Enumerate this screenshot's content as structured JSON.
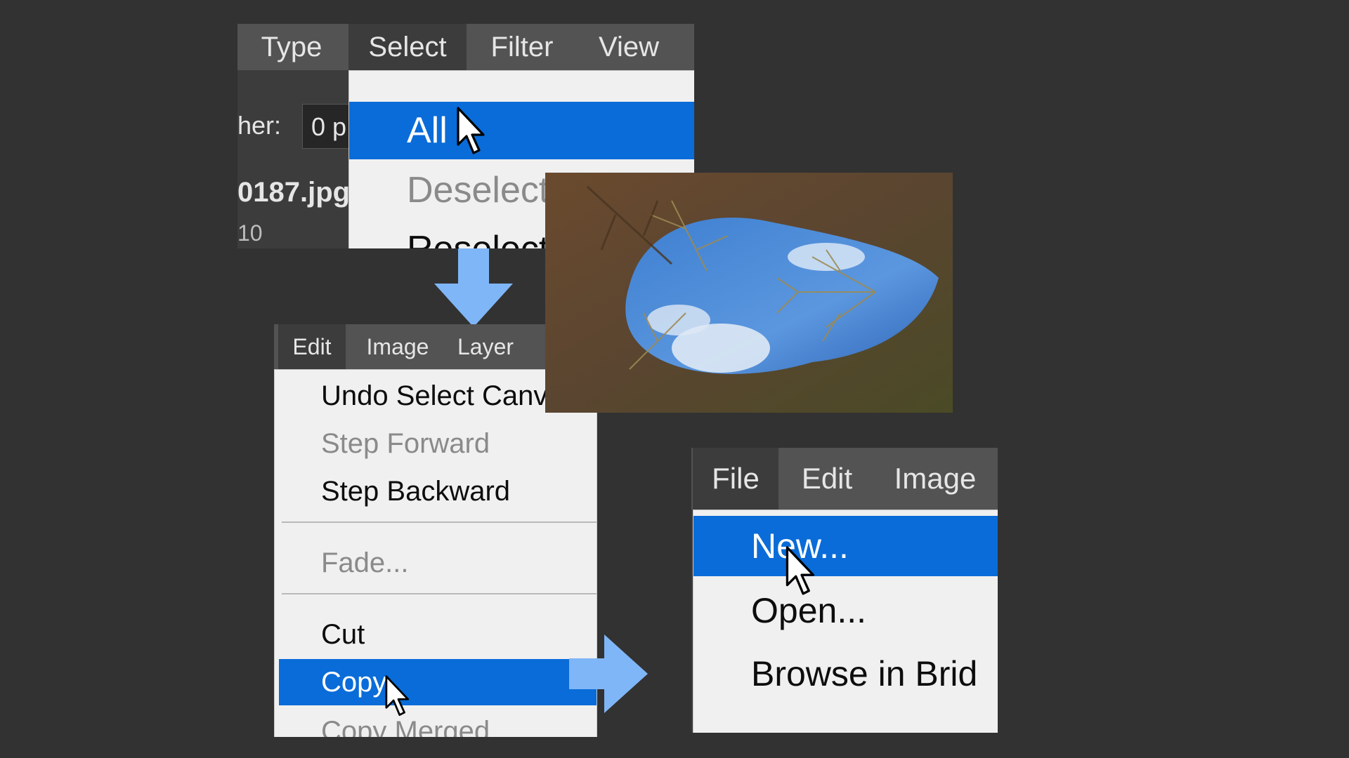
{
  "panel1": {
    "menubar": [
      "Type",
      "Select",
      "Filter",
      "View"
    ],
    "feather_label": "her:",
    "feather_value": "0 p",
    "doc_name": "0187.jpg",
    "doc_zoom": "10",
    "menu": [
      "All",
      "Deselect",
      "Reselect"
    ]
  },
  "panel2": {
    "menubar": [
      "Edit",
      "Image",
      "Layer"
    ],
    "menu": [
      "Undo Select Canv",
      "Step Forward",
      "Step Backward",
      "Fade...",
      "Cut",
      "Copy",
      "Copy Merged"
    ]
  },
  "panel3": {
    "menubar": [
      "File",
      "Edit",
      "Image"
    ],
    "menu": [
      "New...",
      "Open...",
      "Browse in Brid"
    ]
  },
  "colors": {
    "background": "#323232",
    "highlight": "#0a6cd8",
    "arrow": "#7fb6f7",
    "menu_bg": "#f0f0f0"
  },
  "icons": [
    "pointer-cursor-icon",
    "down-arrow-icon",
    "right-arrow-icon"
  ]
}
